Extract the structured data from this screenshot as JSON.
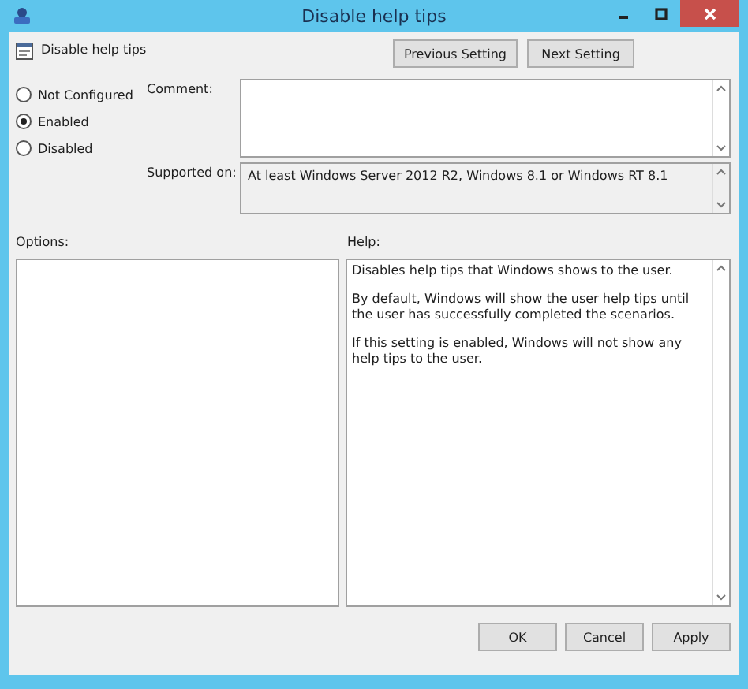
{
  "window": {
    "title": "Disable help tips"
  },
  "header": {
    "title": "Disable help tips",
    "buttons": [
      "Previous Setting",
      "Next Setting"
    ]
  },
  "state_options": [
    {
      "label": "Not Configured",
      "selected": false
    },
    {
      "label": "Enabled",
      "selected": true
    },
    {
      "label": "Disabled",
      "selected": false
    }
  ],
  "comment": {
    "label": "Comment:"
  },
  "supported_on": {
    "label": "Supported on:",
    "value": "At least Windows Server 2012 R2, Windows 8.1 or Windows RT 8.1"
  },
  "options": {
    "label": "Options:"
  },
  "help": {
    "label": "Help:",
    "paragraphs": [
      "Disables help tips that Windows shows to the user.",
      "By default, Windows will show the user help tips until the user has successfully completed the scenarios.",
      "If this setting is enabled, Windows will not show any help tips to the user."
    ]
  },
  "buttons": [
    "OK",
    "Cancel",
    "Apply"
  ]
}
